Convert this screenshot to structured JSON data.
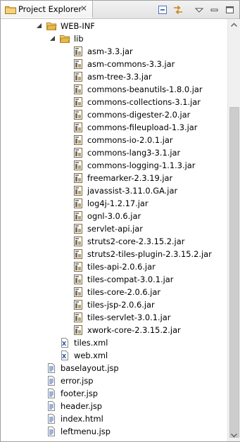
{
  "view": {
    "title": "Project Explorer",
    "close_glyph": "✕",
    "toolbar": [
      {
        "name": "collapse-all-icon"
      },
      {
        "name": "link-with-editor-icon"
      },
      {
        "name": "view-menu-icon"
      },
      {
        "name": "minimize-icon"
      },
      {
        "name": "maximize-icon"
      }
    ]
  },
  "colors": {
    "folder": "#e8b84a",
    "jar": "#7a6a4a",
    "xml_badge": "#1f4fa8",
    "jsp_page": "#3a66b0"
  },
  "tree": {
    "web_inf": {
      "label": "WEB-INF",
      "icon": "folder-open-icon",
      "expanded": true
    },
    "lib": {
      "label": "lib",
      "icon": "folder-open-icon",
      "expanded": true
    },
    "jars": [
      "asm-3.3.jar",
      "asm-commons-3.3.jar",
      "asm-tree-3.3.jar",
      "commons-beanutils-1.8.0.jar",
      "commons-collections-3.1.jar",
      "commons-digester-2.0.jar",
      "commons-fileupload-1.3.jar",
      "commons-io-2.0.1.jar",
      "commons-lang3-3.1.jar",
      "commons-logging-1.1.3.jar",
      "freemarker-2.3.19.jar",
      "javassist-3.11.0.GA.jar",
      "log4j-1.2.17.jar",
      "ognl-3.0.6.jar",
      "servlet-api.jar",
      "struts2-core-2.3.15.2.jar",
      "struts2-tiles-plugin-2.3.15.2.jar",
      "tiles-api-2.0.6.jar",
      "tiles-compat-3.0.1.jar",
      "tiles-core-2.0.6.jar",
      "tiles-jsp-2.0.6.jar",
      "tiles-servlet-3.0.1.jar",
      "xwork-core-2.3.15.2.jar"
    ],
    "xml_files": [
      "tiles.xml",
      "web.xml"
    ],
    "pages": [
      "baselayout.jsp",
      "error.jsp",
      "footer.jsp",
      "header.jsp",
      "index.html",
      "leftmenu.jsp"
    ]
  }
}
